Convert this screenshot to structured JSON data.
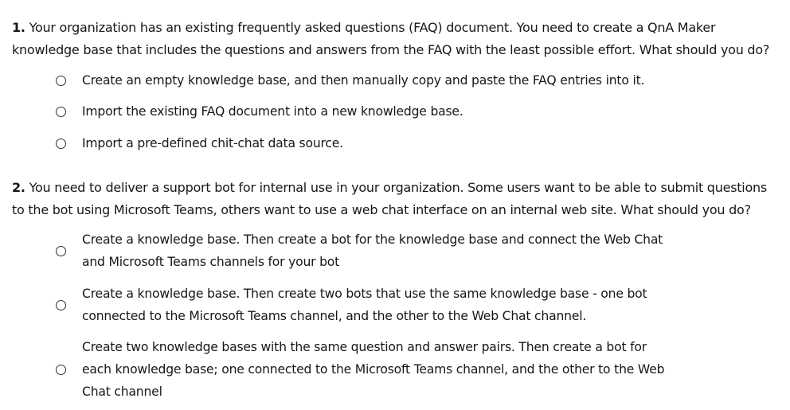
{
  "questions": [
    {
      "number": "1.",
      "text": "Your organization has an existing frequently asked questions (FAQ) document. You need to create a QnA Maker knowledge base that includes the questions and answers from the FAQ with the least possible effort. What should you do?",
      "options": [
        "Create an empty knowledge base, and then manually copy and paste the FAQ entries into it.",
        "Import the existing FAQ document into a new knowledge base.",
        "Import a pre-defined chit-chat data source."
      ]
    },
    {
      "number": "2.",
      "text": "You need to deliver a support bot for internal use in your organization. Some users want to be able to submit questions to the bot using Microsoft Teams, others want to use a web chat interface on an internal web site. What should you do?",
      "options": [
        "Create a knowledge base. Then create a bot for the knowledge base and connect the Web Chat and Microsoft Teams channels for your bot",
        "Create a knowledge base. Then create two bots that use the same knowledge base - one bot connected to the Microsoft Teams channel, and the other to the Web Chat channel.",
        "Create two knowledge bases with the same question and answer pairs. Then create a bot for each knowledge base; one connected to the Microsoft Teams channel, and the other to the Web Chat channel"
      ]
    }
  ]
}
